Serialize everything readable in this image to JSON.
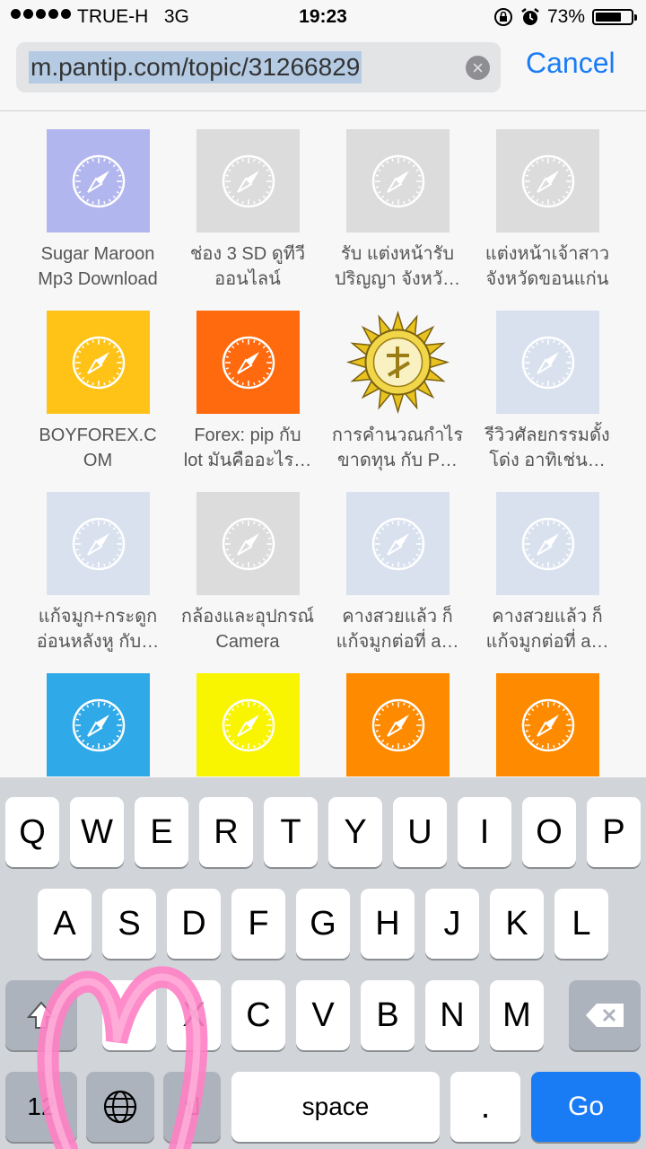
{
  "status_bar": {
    "carrier": "TRUE-H",
    "network": "3G",
    "time": "19:23",
    "battery": "73%",
    "battery_level": 0.73
  },
  "address_bar": {
    "url": "m.pantip.com/topic/31266829",
    "cancel_label": "Cancel"
  },
  "favorites": [
    {
      "label": "Sugar Maroon\nMp3 Download",
      "color": "#b2b6ee"
    },
    {
      "label": "ช่อง 3 SD ดูทีวี\nออนไลน์",
      "color": "#dcdcdc"
    },
    {
      "label": "รับ แต่งหน้ารับ\nปริญญา จังหวั…",
      "color": "#dcdcdc"
    },
    {
      "label": "แต่งหน้าเจ้าสาว\nจังหวัดขอนแก่น",
      "color": "#dcdcdc"
    },
    {
      "label": "BOYFOREX.C\nOM",
      "color": "#fec316"
    },
    {
      "label": "Forex: pip กับ\nlot มันคืออะไร…",
      "color": "#fe6a0d"
    },
    {
      "label": "การคำนวณกำไร\nขาดทุน กับ P…",
      "color": "#f7f7f7",
      "logo": "sun-logo"
    },
    {
      "label": "รีวิวศัลยกรรมดั้ง\nโด่ง อาทิเช่น…",
      "color": "#d9e1ef"
    },
    {
      "label": "แก้จมูก+กระดูก\nอ่อนหลังหู กับ…",
      "color": "#d9e1ef"
    },
    {
      "label": "กล้องและอุปกรณ์\nCamera",
      "color": "#dcdcdc"
    },
    {
      "label": "คางสวยแล้ว ก็\nแก้จมูกต่อที่ a…",
      "color": "#d9e1ef"
    },
    {
      "label": "คางสวยแล้ว ก็\nแก้จมูกต่อที่ a…",
      "color": "#d9e1ef"
    },
    {
      "label": "",
      "color": "#30a9e8"
    },
    {
      "label": "",
      "color": "#f9f400"
    },
    {
      "label": "",
      "color": "#fe8a00"
    },
    {
      "label": "",
      "color": "#fe8a00"
    }
  ],
  "keyboard": {
    "row1": [
      "Q",
      "W",
      "E",
      "R",
      "T",
      "Y",
      "U",
      "I",
      "O",
      "P"
    ],
    "row2": [
      "A",
      "S",
      "D",
      "F",
      "G",
      "H",
      "J",
      "K",
      "L"
    ],
    "row3_visible": [
      "X",
      "C",
      "V",
      "B",
      "N",
      "M"
    ],
    "numbers_key": "12",
    "dictation_key": "ป",
    "space_label": "space",
    "period_label": ".",
    "go_label": "Go",
    "icons": [
      "shift-icon",
      "backspace-icon",
      "globe-icon"
    ]
  }
}
